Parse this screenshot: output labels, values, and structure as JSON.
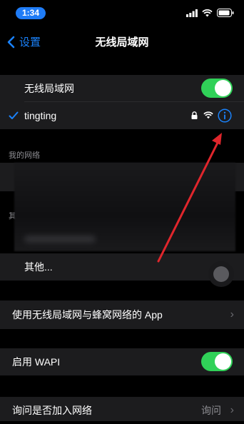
{
  "status": {
    "time": "1:34"
  },
  "nav": {
    "back_label": "设置",
    "title": "无线局域网"
  },
  "wifi_group": {
    "toggle_label": "无线局域网",
    "toggle_on": true,
    "connected_network": "tingting"
  },
  "my_networks_header": "我的网络",
  "other_networks_header_partial": "其",
  "other_label": "其他...",
  "app_row_label": "使用无线局域网与蜂窝网络的 App",
  "wapi": {
    "label": "启用 WAPI",
    "on": true
  },
  "ask_join": {
    "label": "询问是否加入网络",
    "value": "询问"
  },
  "colors": {
    "accent": "#1a82fb",
    "toggle_on": "#30d158",
    "arrow": "#e0262c"
  }
}
